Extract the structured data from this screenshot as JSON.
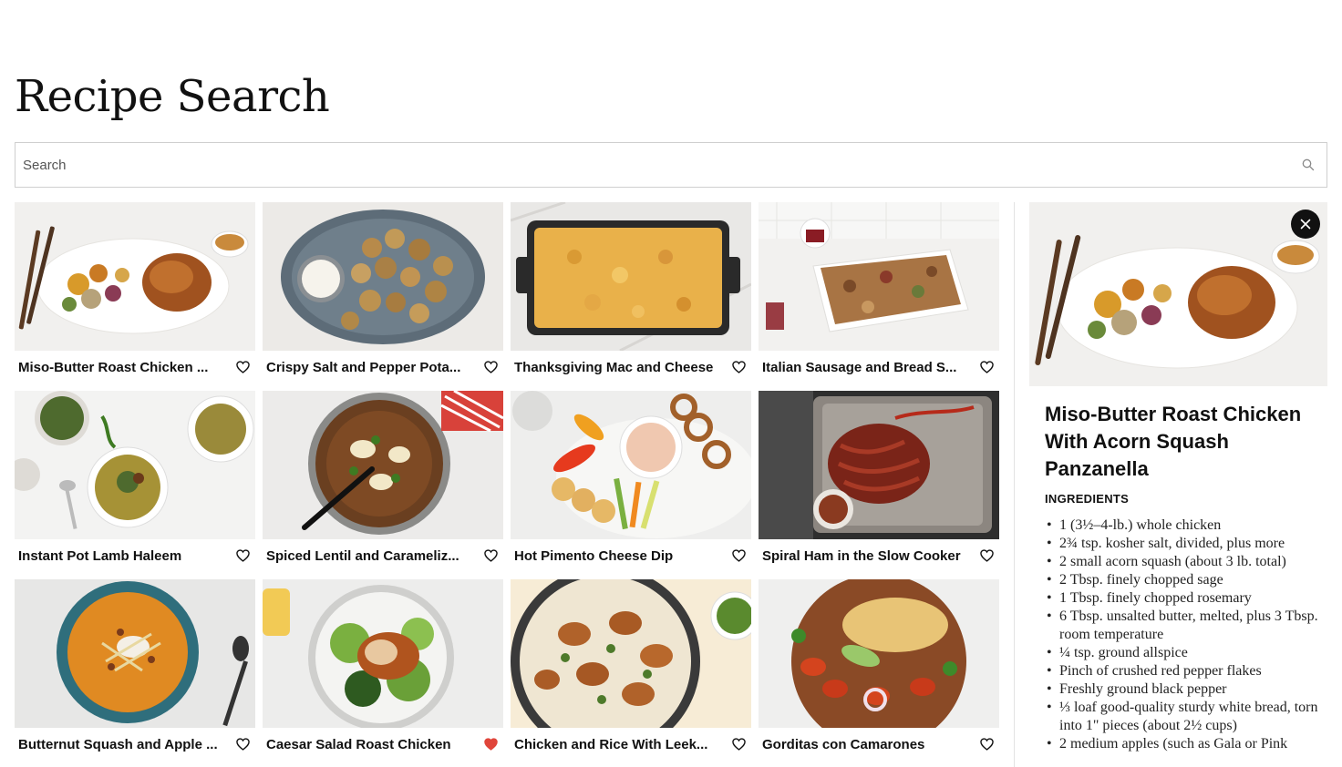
{
  "page": {
    "title": "Recipe Search"
  },
  "search": {
    "placeholder": "Search",
    "value": ""
  },
  "recipes": [
    {
      "title": "Miso-Butter Roast Chicken ...",
      "favorited": false
    },
    {
      "title": "Crispy Salt and Pepper Pota...",
      "favorited": false
    },
    {
      "title": "Thanksgiving Mac and Cheese",
      "favorited": false
    },
    {
      "title": "Italian Sausage and Bread S...",
      "favorited": false
    },
    {
      "title": "Instant Pot Lamb Haleem",
      "favorited": false
    },
    {
      "title": "Spiced Lentil and Carameliz...",
      "favorited": false
    },
    {
      "title": "Hot Pimento Cheese Dip",
      "favorited": false
    },
    {
      "title": "Spiral Ham in the Slow Cooker",
      "favorited": false
    },
    {
      "title": "Butternut Squash and Apple ...",
      "favorited": false
    },
    {
      "title": "Caesar Salad Roast Chicken",
      "favorited": true
    },
    {
      "title": "Chicken and Rice With Leek...",
      "favorited": false
    },
    {
      "title": "Gorditas con Camarones",
      "favorited": false
    }
  ],
  "detail": {
    "title": "Miso-Butter Roast Chicken With Acorn Squash Panzanella",
    "ingredients_heading": "INGREDIENTS",
    "ingredients": [
      "1 (3½–4-lb.) whole chicken",
      "2¾ tsp. kosher salt, divided, plus more",
      "2 small acorn squash (about 3 lb. total)",
      "2 Tbsp. finely chopped sage",
      "1 Tbsp. finely chopped rosemary",
      "6 Tbsp. unsalted butter, melted, plus 3 Tbsp. room temperature",
      "¼ tsp. ground allspice",
      "Pinch of crushed red pepper flakes",
      "Freshly ground black pepper",
      "⅓ loaf good-quality sturdy white bread, torn into 1\" pieces (about 2½ cups)",
      "2 medium apples (such as Gala or Pink"
    ]
  },
  "colors": {
    "heart_active": "#e0453a",
    "heart_inactive": "#111111",
    "border": "#cfcfcf"
  }
}
